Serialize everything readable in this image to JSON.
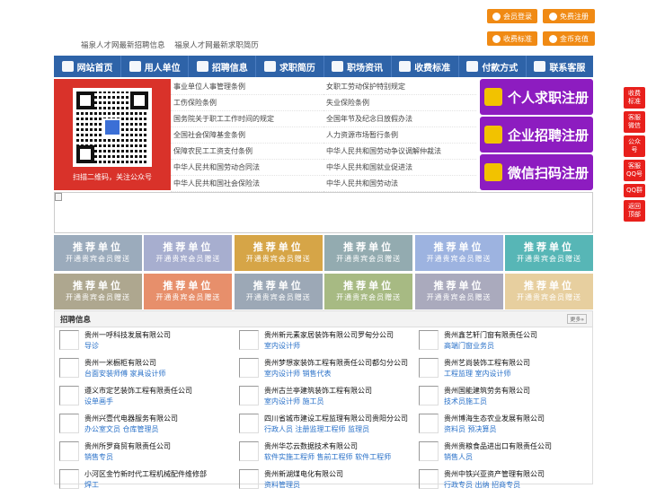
{
  "top_buttons": [
    "会员登录",
    "免费注册",
    "收费标准",
    "金币充值"
  ],
  "head_links": [
    "福泉人才网最新招聘信息",
    "福泉人才网最新求职简历"
  ],
  "nav": [
    "网站首页",
    "用人单位",
    "招聘信息",
    "求职简历",
    "职场资讯",
    "收费标准",
    "付款方式",
    "联系客服"
  ],
  "qr_caption": "扫描二维码，关注公众号",
  "laws": [
    "事业单位人事管理条例",
    "女职工劳动保护特别规定",
    "工伤保险条例",
    "失业保险条例",
    "国务院关于职工工作时间的规定",
    "全国年节及纪念日放假办法",
    "全国社会保障基金条例",
    "人力资源市场暂行条例",
    "保障农民工工资支付条例",
    "中华人民共和国劳动争议调解仲裁法",
    "中华人民共和国劳动合同法",
    "中华人民共和国就业促进法",
    "中华人民共和国社会保险法",
    "中华人民共和国劳动法"
  ],
  "registers": [
    "个人求职注册",
    "企业招聘注册",
    "微信扫码注册"
  ],
  "rec_title": "推荐单位",
  "rec_sub": "开通贵宾会员赠送",
  "rec_colors": [
    "#7a8fa6",
    "#8a93c0",
    "#c9870a",
    "#6f9096",
    "#7d9ad6",
    "#1f9e9e",
    "#948a6a",
    "#e06a3a",
    "#7b8c9e",
    "#8aa35a",
    "#8e8ea8",
    "#e0c080"
  ],
  "jobs_title": "招聘信息",
  "more": "更多»",
  "jobs": [
    {
      "name": "贵州一呼科技发展有限公司",
      "pos": "导诊"
    },
    {
      "name": "贵州新元素家居装饰有限公司罗甸分公司",
      "pos": "室内设计师"
    },
    {
      "name": "贵州鑫艺轩门窗有限责任公司",
      "pos": "高端门窗业务员"
    },
    {
      "name": "贵州一米橱柜有限公司",
      "pos": "台面安装师傅 家具设计师"
    },
    {
      "name": "贵州梦想家装饰工程有限责任公司都匀分公司",
      "pos": "室内设计师 销售代表"
    },
    {
      "name": "贵州艺尚装饰工程有限公司",
      "pos": "工程监理 室内设计师"
    },
    {
      "name": "遵义市定艺装饰工程有限责任公司",
      "pos": "设单画手"
    },
    {
      "name": "贵州古兰亭建筑装饰工程有限公司",
      "pos": "室内设计师 施工员"
    },
    {
      "name": "贵州国能建筑劳务有限公司",
      "pos": "技术员施工员"
    },
    {
      "name": "贵州兴壹代电器服务有限公司",
      "pos": "办公室文员 仓库管理员"
    },
    {
      "name": "四川省城市建设工程监理有限公司贵阳分公司",
      "pos": "行政人员 注册监理工程师 监理员"
    },
    {
      "name": "贵州博海生态农业发展有限公司",
      "pos": "资料员 预决算员"
    },
    {
      "name": "贵州所罗商贸有限责任公司",
      "pos": "销售专员"
    },
    {
      "name": "贵州华芯云数据技术有限公司",
      "pos": "软件实施工程师 售前工程师 软件工程师"
    },
    {
      "name": "贵州贵粮食品进出口有限责任公司",
      "pos": "销售人员"
    },
    {
      "name": "小河区金竹新时代工程机械配件维修部",
      "pos": "焊工"
    },
    {
      "name": "贵州新湖煤电化有限公司",
      "pos": "资料管理员"
    },
    {
      "name": "贵州中铁兴亚资产管理有限公司",
      "pos": "行政专员 出纳 招商专员"
    }
  ],
  "side": [
    "收费标准",
    "客服微信",
    "公众号",
    "客服QQ号",
    "QQ群",
    "返回顶部"
  ]
}
